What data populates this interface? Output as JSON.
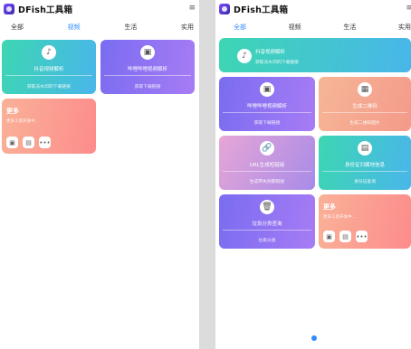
{
  "left": {
    "app_title": "DFish工具箱",
    "menu_glyph": "≡",
    "tabs": [
      "全部",
      "视频",
      "生活",
      "实用"
    ],
    "active_tab": "视频",
    "cards": [
      {
        "name": "抖音视频解析",
        "sub": "获取去水印的下载链接",
        "icon": "♪"
      },
      {
        "name": "哔哩哔哩视频解析",
        "sub": "获取下载链接",
        "icon": "▣"
      }
    ],
    "more": {
      "title": "更多",
      "sub": "更多工具开发中..."
    }
  },
  "right": {
    "app_title": "DFish工具箱",
    "menu_glyph": "≡",
    "tabs": [
      "全部",
      "视频",
      "生活",
      "实用"
    ],
    "active_tab": "全部",
    "banner": {
      "name": "抖音视频解析",
      "sub": "获取去水印的下载链接",
      "icon": "♪"
    },
    "cards": [
      {
        "name": "哔哩哔哩视频解析",
        "sub": "获取下载链接",
        "icon": "▣"
      },
      {
        "name": "生成二维码",
        "sub": "生成二维码图片",
        "icon": "▦"
      },
      {
        "name": "URL生成短链接",
        "sub": "生成带失效期链接",
        "icon": "🔗"
      },
      {
        "name": "身份证归属地信息",
        "sub": "身份证查询",
        "icon": "▤"
      },
      {
        "name": "垃圾分类查询",
        "sub": "垃圾分类",
        "icon": "🗑"
      }
    ],
    "more": {
      "title": "更多",
      "sub": "更多工具开发中..."
    }
  },
  "colors": {
    "accent": "#2f8cff",
    "teal": "#3dd6b3",
    "purple": "#7a6cf0",
    "peach": "#fc9b88"
  }
}
